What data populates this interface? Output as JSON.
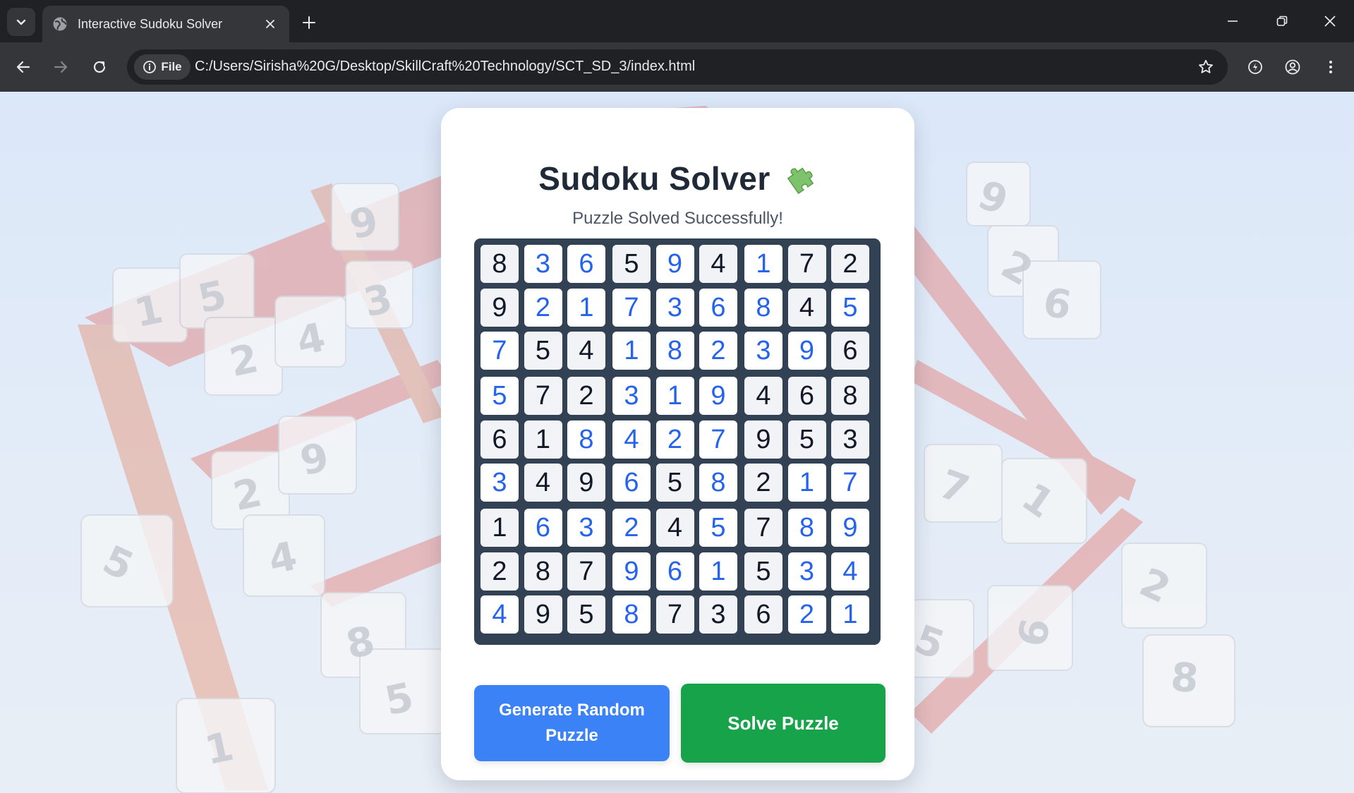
{
  "browser": {
    "tab_title": "Interactive Sudoku Solver",
    "site_chip_label": "File",
    "url": "C:/Users/Sirisha%20G/Desktop/SkillCraft%20Technology/SCT_SD_3/index.html"
  },
  "page": {
    "title": "Sudoku Solver",
    "status": "Puzzle Solved Successfully!",
    "generate_button": "Generate Random Puzzle",
    "solve_button": "Solve Puzzle"
  },
  "colors": {
    "board_border": "#334155",
    "given_text": "#111827",
    "solved_text": "#2563eb",
    "generate_button": "#3b82f6",
    "solve_button": "#16a34a"
  },
  "board": {
    "rows": [
      [
        8,
        3,
        6,
        5,
        9,
        4,
        1,
        7,
        2
      ],
      [
        9,
        2,
        1,
        7,
        3,
        6,
        8,
        4,
        5
      ],
      [
        7,
        5,
        4,
        1,
        8,
        2,
        3,
        9,
        6
      ],
      [
        5,
        7,
        2,
        3,
        1,
        9,
        4,
        6,
        8
      ],
      [
        6,
        1,
        8,
        4,
        2,
        7,
        9,
        5,
        3
      ],
      [
        3,
        4,
        9,
        6,
        5,
        8,
        2,
        1,
        7
      ],
      [
        1,
        6,
        3,
        2,
        4,
        5,
        7,
        8,
        9
      ],
      [
        2,
        8,
        7,
        9,
        6,
        1,
        5,
        3,
        4
      ],
      [
        4,
        9,
        5,
        8,
        7,
        3,
        6,
        2,
        1
      ]
    ],
    "given": [
      [
        1,
        0,
        0,
        1,
        0,
        1,
        0,
        1,
        1
      ],
      [
        1,
        0,
        0,
        0,
        0,
        0,
        0,
        1,
        0
      ],
      [
        0,
        1,
        1,
        0,
        0,
        0,
        0,
        0,
        1
      ],
      [
        0,
        1,
        1,
        0,
        0,
        0,
        1,
        1,
        1
      ],
      [
        1,
        1,
        0,
        0,
        0,
        0,
        1,
        1,
        1
      ],
      [
        0,
        1,
        1,
        0,
        1,
        0,
        1,
        0,
        0
      ],
      [
        1,
        0,
        0,
        0,
        1,
        0,
        1,
        0,
        0
      ],
      [
        1,
        1,
        1,
        0,
        0,
        0,
        1,
        0,
        0
      ],
      [
        0,
        1,
        1,
        0,
        1,
        1,
        1,
        0,
        0
      ]
    ]
  }
}
